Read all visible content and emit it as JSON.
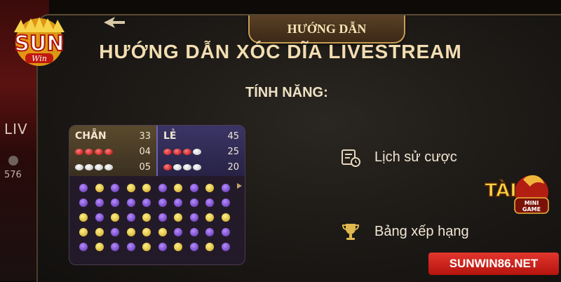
{
  "header": {
    "tab_title": "HƯỚNG DẪN"
  },
  "title": "HƯỚNG DẪN XÓC DĨA LIVESTREAM",
  "subtitle": "TÍNH NĂNG:",
  "background": {
    "live_tag": "LIV",
    "viewer_count": "576"
  },
  "board": {
    "even": {
      "label": "CHẴN",
      "count": "33",
      "rows": [
        {
          "balls": [
            "red",
            "red",
            "red",
            "red"
          ],
          "num": "04"
        },
        {
          "balls": [
            "white",
            "white",
            "white",
            "white"
          ],
          "num": "05"
        }
      ]
    },
    "odd": {
      "label": "LẺ",
      "count": "45",
      "rows": [
        {
          "balls": [
            "red",
            "red",
            "red",
            "white"
          ],
          "num": "25"
        },
        {
          "balls": [
            "red",
            "white",
            "white",
            "white"
          ],
          "num": "20"
        }
      ]
    },
    "grid": [
      [
        "p",
        "y",
        "p",
        "y",
        "y",
        "p",
        "y",
        "p",
        "y",
        "p"
      ],
      [
        "p",
        "p",
        "p",
        "p",
        "p",
        "p",
        "p",
        "p",
        "p",
        "p"
      ],
      [
        "y",
        "p",
        "y",
        "p",
        "y",
        "p",
        "y",
        "p",
        "y",
        "y"
      ],
      [
        "y",
        "y",
        "p",
        "y",
        "y",
        "y",
        "p",
        "p",
        "p",
        "p"
      ],
      [
        "p",
        "y",
        "p",
        "p",
        "y",
        "p",
        "y",
        "p",
        "y",
        "p"
      ]
    ]
  },
  "features": [
    {
      "icon": "calendar-clock-icon",
      "label": "Lịch sử cược"
    },
    {
      "icon": "trophy-icon",
      "label": "Bảng xếp hạng"
    }
  ],
  "logos": {
    "sun": "SUN",
    "sun_sub": "Win",
    "tai": "TÀI",
    "mini_game": "MINI GAME"
  },
  "domain": "SUNWIN86.NET",
  "colors": {
    "gold": "#f3deb2",
    "accent_red": "#e2362c",
    "purple": "#6c63b0"
  }
}
